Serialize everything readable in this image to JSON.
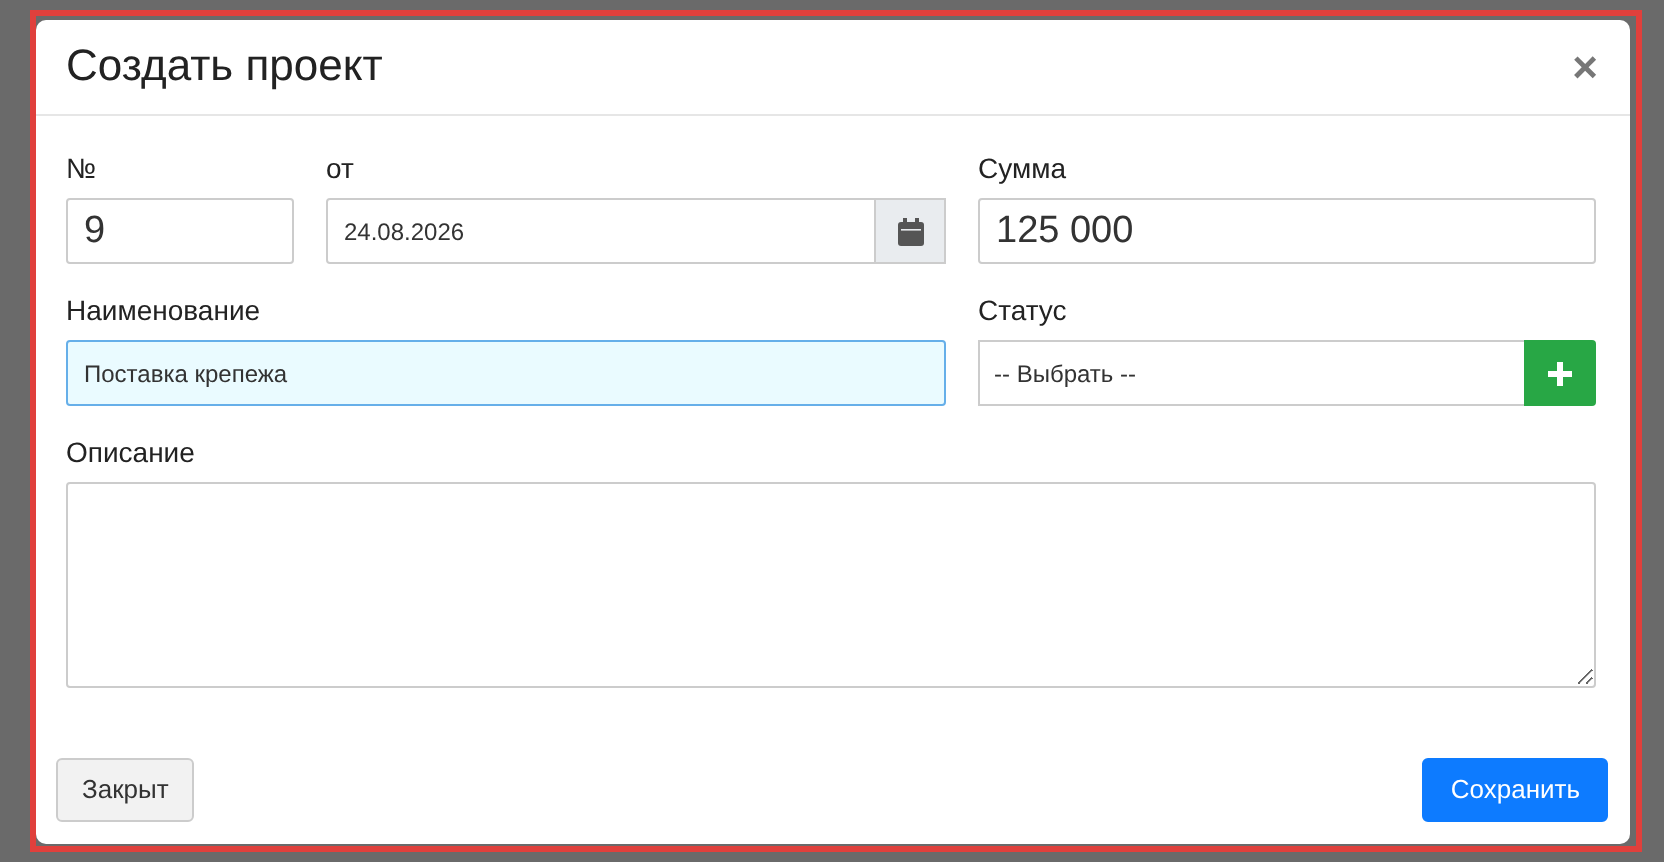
{
  "dialog": {
    "title": "Создать проект",
    "close_label": "×",
    "number": {
      "label": "№",
      "value": "9"
    },
    "date": {
      "label": "от",
      "value": "24.08.2026"
    },
    "sum": {
      "label": "Сумма",
      "value": "125 000"
    },
    "name": {
      "label": "Наименование",
      "value": "Поставка крепежа",
      "focused": true
    },
    "status": {
      "label": "Статус",
      "value": "-- Выбрать --"
    },
    "description": {
      "label": "Описание"
    },
    "buttons": [
      {
        "label": "Закрыт",
        "kind": "secondary"
      },
      {
        "label": "Сохранить",
        "kind": "primary"
      }
    ]
  }
}
